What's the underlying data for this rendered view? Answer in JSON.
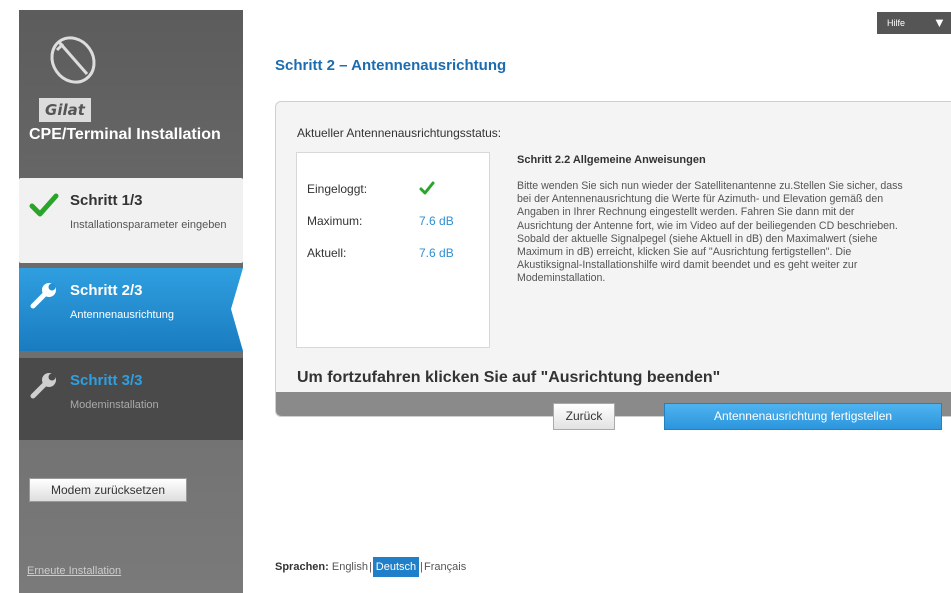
{
  "sidebar": {
    "logo_text": "Gilat",
    "app_title": "CPE/Terminal Installation",
    "steps": [
      {
        "title": "Schritt 1/3",
        "subtitle": "Installationsparameter eingeben",
        "state": "done"
      },
      {
        "title": "Schritt 2/3",
        "subtitle": "Antennenausrichtung",
        "state": "active"
      },
      {
        "title": "Schritt 3/3",
        "subtitle": "Modeminstallation",
        "state": "pending"
      }
    ],
    "reset_button": "Modem zurücksetzen",
    "reinstall_link": "Erneute Installation"
  },
  "help": {
    "label": "Hilfe"
  },
  "main": {
    "title": "Schritt 2 – Antennenausrichtung",
    "panel_heading": "Aktueller Antennenausrichtungsstatus:",
    "status": {
      "logged_in_label": "Eingeloggt:",
      "max_label": "Maximum:",
      "max_value": "7.6 dB",
      "current_label": "Aktuell:",
      "current_value": "7.6 dB"
    },
    "instructions_title": "Schritt 2.2 Allgemeine Anweisungen",
    "instructions_body": "Bitte wenden Sie sich nun wieder der Satellitenantenne zu.Stellen Sie sicher, dass bei der Antennenausrichtung die Werte für Azimuth- und Elevation gemäß den Angaben in Ihrer Rechnung eingestellt werden. Fahren Sie dann mit der Ausrichtung der Antenne fort, wie im Video auf der beiliegenden CD beschrieben. Sobald der aktuelle Signalpegel (siehe Aktuell in dB) den Maximalwert (siehe Maximum in dB) erreicht, klicken Sie auf \"Ausrichtung fertigstellen\". Die Akustiksignal-Installationshilfe wird damit beendet und es geht weiter zur Modeminstallation.",
    "continue_text": "Um fortzufahren klicken Sie auf \"Ausrichtung beenden\"",
    "back_button": "Zurück",
    "finish_button": "Antennenausrichtung fertigstellen"
  },
  "language": {
    "label": "Sprachen:",
    "options": [
      "English",
      "Deutsch",
      "Français"
    ],
    "selected": "Deutsch"
  },
  "colors": {
    "accent": "#2f9fe0",
    "title_blue": "#1b6cb0",
    "check_green": "#2aa52a",
    "sidebar_dark": "#5c5c5c"
  }
}
